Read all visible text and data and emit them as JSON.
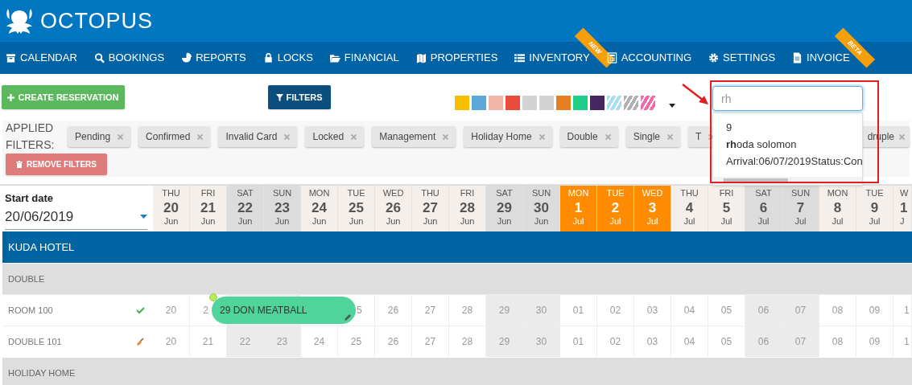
{
  "logo": {
    "text": "OCTOPUS"
  },
  "nav": [
    {
      "label": "CALENDAR"
    },
    {
      "label": "BOOKINGS"
    },
    {
      "label": "REPORTS"
    },
    {
      "label": "LOCKS"
    },
    {
      "label": "FINANCIAL"
    },
    {
      "label": "PROPERTIES"
    },
    {
      "label": "INVENTORY",
      "ribbon": "NEW"
    },
    {
      "label": "ACCOUNTING"
    },
    {
      "label": "SETTINGS"
    },
    {
      "label": "INVOICE",
      "ribbon": "BETA"
    }
  ],
  "toolbar": {
    "create_button": "CREATE RESERVATION",
    "filters_button": "FILTERS",
    "swatches": [
      {
        "color": "#f9bd00",
        "kind": "solid"
      },
      {
        "color": "#5aa8d8",
        "kind": "solid"
      },
      {
        "color": "#f2b6a8",
        "kind": "solid"
      },
      {
        "color": "#e74c3c",
        "kind": "solid"
      },
      {
        "color": "#d3d3d3",
        "kind": "solid"
      },
      {
        "color": "#d3d3d3",
        "kind": "solid"
      },
      {
        "color": "#e67e22",
        "kind": "solid"
      },
      {
        "color": "#1fcc8a",
        "kind": "solid"
      },
      {
        "color": "#45265e",
        "kind": "solid"
      },
      {
        "color": "#a8dff0",
        "kind": "striped"
      },
      {
        "color": "#b0b0b0",
        "kind": "striped"
      },
      {
        "color": "#f06ba8",
        "kind": "striped"
      }
    ],
    "search": {
      "value": "rh",
      "results": [
        "9",
        "**rh**oda solomon",
        "Arrival:06/07/2019Status:Con"
      ]
    }
  },
  "applied_filters": {
    "label": "APPLIED FILTERS:",
    "chips": [
      {
        "label": "Pending"
      },
      {
        "label": "Confirmed"
      },
      {
        "label": "Invalid Card"
      },
      {
        "label": "Locked"
      },
      {
        "label": "Management"
      },
      {
        "label": "Holiday Home"
      },
      {
        "label": "Double"
      },
      {
        "label": "Single"
      },
      {
        "label": "T",
        "hidden_right": true
      },
      {
        "label": "druple",
        "hidden_left": true
      }
    ],
    "remove_button": "REMOVE FILTERS"
  },
  "calendar": {
    "start_date_label": "Start date",
    "start_date": "20/06/2019",
    "days": [
      {
        "dow": "THU",
        "day": "20",
        "month": "Jun",
        "weekend": false,
        "highlighted": false
      },
      {
        "dow": "FRI",
        "day": "21",
        "month": "Jun",
        "weekend": false,
        "highlighted": false
      },
      {
        "dow": "SAT",
        "day": "22",
        "month": "Jun",
        "weekend": true,
        "highlighted": false
      },
      {
        "dow": "SUN",
        "day": "23",
        "month": "Jun",
        "weekend": true,
        "highlighted": false
      },
      {
        "dow": "MON",
        "day": "24",
        "month": "Jun",
        "weekend": false,
        "highlighted": false
      },
      {
        "dow": "TUE",
        "day": "25",
        "month": "Jun",
        "weekend": false,
        "highlighted": false
      },
      {
        "dow": "WED",
        "day": "26",
        "month": "Jun",
        "weekend": false,
        "highlighted": false
      },
      {
        "dow": "THU",
        "day": "27",
        "month": "Jun",
        "weekend": false,
        "highlighted": false
      },
      {
        "dow": "FRI",
        "day": "28",
        "month": "Jun",
        "weekend": false,
        "highlighted": false
      },
      {
        "dow": "SAT",
        "day": "29",
        "month": "Jun",
        "weekend": true,
        "highlighted": false
      },
      {
        "dow": "SUN",
        "day": "30",
        "month": "Jun",
        "weekend": true,
        "highlighted": false
      },
      {
        "dow": "MON",
        "day": "1",
        "month": "Jul",
        "weekend": false,
        "highlighted": true
      },
      {
        "dow": "TUE",
        "day": "2",
        "month": "Jul",
        "weekend": false,
        "highlighted": true
      },
      {
        "dow": "WED",
        "day": "3",
        "month": "Jul",
        "weekend": false,
        "highlighted": true
      },
      {
        "dow": "THU",
        "day": "4",
        "month": "Jul",
        "weekend": false,
        "highlighted": false
      },
      {
        "dow": "FRI",
        "day": "5",
        "month": "Jul",
        "weekend": false,
        "highlighted": false
      },
      {
        "dow": "SAT",
        "day": "6",
        "month": "Jul",
        "weekend": true,
        "highlighted": false
      },
      {
        "dow": "SUN",
        "day": "7",
        "month": "Jul",
        "weekend": true,
        "highlighted": false
      },
      {
        "dow": "MON",
        "day": "8",
        "month": "Jul",
        "weekend": false,
        "highlighted": false
      },
      {
        "dow": "TUE",
        "day": "9",
        "month": "Jul",
        "weekend": false,
        "highlighted": false
      },
      {
        "dow": "W",
        "day": "1",
        "month": "J",
        "weekend": false,
        "highlighted": false,
        "partial": true
      }
    ],
    "property": "KUDA HOTEL",
    "groups": [
      {
        "name": "DOUBLE",
        "rooms": [
          {
            "name": "ROOM 100",
            "clean": true,
            "booking": {
              "label": "29 DON MEATBALL"
            },
            "cells": [
              {
                "text": "20",
                "booked": false
              },
              {
                "text": "2",
                "booked": true
              },
              {
                "booked": true
              },
              {
                "booked": true
              },
              {
                "booked": true
              },
              {
                "text": "5",
                "booked": true
              },
              {
                "text": "26",
                "booked": false
              },
              {
                "text": "27",
                "booked": false
              },
              {
                "text": "28",
                "booked": false
              },
              {
                "text": "29",
                "booked": false
              },
              {
                "text": "30",
                "booked": false
              },
              {
                "text": "01",
                "booked": false
              },
              {
                "text": "02",
                "booked": false
              },
              {
                "text": "03",
                "booked": false
              },
              {
                "text": "04",
                "booked": false
              },
              {
                "text": "05",
                "booked": false
              },
              {
                "text": "06",
                "booked": false
              },
              {
                "text": "07",
                "booked": false
              },
              {
                "text": "08",
                "booked": false
              },
              {
                "text": "09",
                "booked": false
              },
              {
                "text": "1",
                "booked": false
              }
            ]
          },
          {
            "name": "DOUBLE 101",
            "clean": false,
            "cells": [
              {
                "text": "20",
                "booked": false
              },
              {
                "text": "21",
                "booked": false
              },
              {
                "text": "22",
                "booked": false
              },
              {
                "text": "23",
                "booked": false
              },
              {
                "text": "24",
                "booked": false
              },
              {
                "text": "25",
                "booked": false
              },
              {
                "text": "26",
                "booked": false
              },
              {
                "text": "27",
                "booked": false
              },
              {
                "text": "28",
                "booked": false
              },
              {
                "text": "29",
                "booked": false
              },
              {
                "text": "30",
                "booked": false
              },
              {
                "text": "01",
                "booked": false
              },
              {
                "text": "02",
                "booked": false
              },
              {
                "text": "03",
                "booked": false
              },
              {
                "text": "04",
                "booked": false
              },
              {
                "text": "05",
                "booked": false
              },
              {
                "text": "06",
                "booked": false
              },
              {
                "text": "07",
                "booked": false
              },
              {
                "text": "08",
                "booked": false
              },
              {
                "text": "09",
                "booked": false
              },
              {
                "text": "1",
                "booked": false
              }
            ]
          }
        ]
      },
      {
        "name": "HOLIDAY HOME"
      }
    ]
  }
}
